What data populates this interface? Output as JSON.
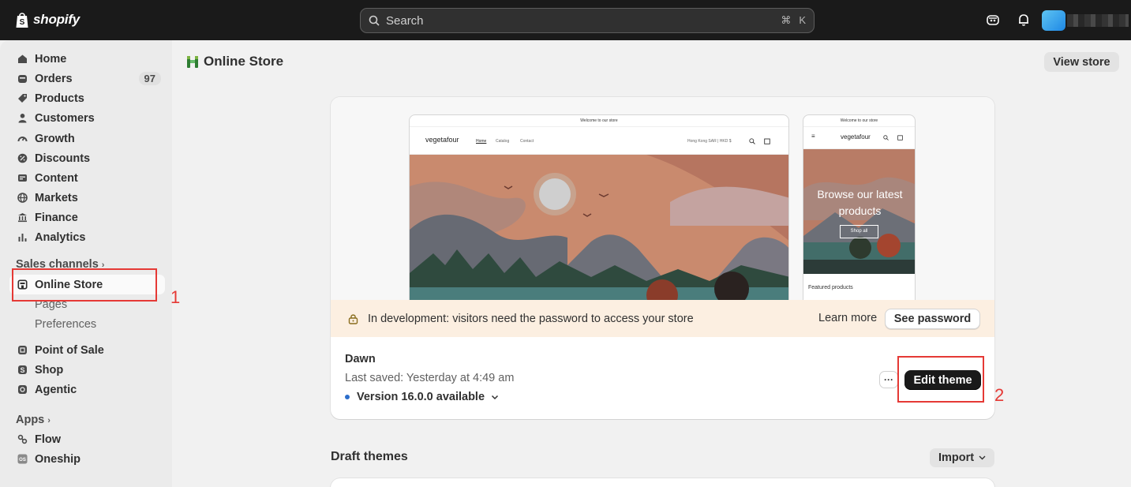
{
  "topbar": {
    "brand": "shopify",
    "search_placeholder": "Search",
    "shortcut_cmd": "⌘",
    "shortcut_key": "K"
  },
  "sidebar": {
    "items": [
      {
        "label": "Home",
        "icon": "home-icon"
      },
      {
        "label": "Orders",
        "icon": "orders-icon",
        "badge": "97"
      },
      {
        "label": "Products",
        "icon": "tag-icon"
      },
      {
        "label": "Customers",
        "icon": "person-icon"
      },
      {
        "label": "Growth",
        "icon": "gauge-icon"
      },
      {
        "label": "Discounts",
        "icon": "discount-icon"
      },
      {
        "label": "Content",
        "icon": "content-icon"
      },
      {
        "label": "Markets",
        "icon": "globe-icon"
      },
      {
        "label": "Finance",
        "icon": "bank-icon"
      },
      {
        "label": "Analytics",
        "icon": "bar-chart-icon"
      }
    ],
    "sales_channels_label": "Sales channels",
    "online_store": "Online Store",
    "sub_items": [
      "Pages",
      "Preferences"
    ],
    "channels": [
      {
        "label": "Point of Sale",
        "icon": "pos-icon"
      },
      {
        "label": "Shop",
        "icon": "shop-icon"
      },
      {
        "label": "Agentic",
        "icon": "agentic-icon"
      }
    ],
    "apps_label": "Apps",
    "apps": [
      {
        "label": "Flow",
        "icon": "flow-icon"
      },
      {
        "label": "Oneship",
        "icon": "oneship-icon"
      }
    ]
  },
  "header": {
    "title": "Online Store",
    "view_store": "View store"
  },
  "preview": {
    "announcement": "Welcome to our store",
    "store_name": "vegetafour",
    "nav": [
      "Home",
      "Catalog",
      "Contact"
    ],
    "currency": "Hong Kong SAR | HKD $",
    "mobile_hero_title": "Browse our latest products",
    "mobile_shop_all": "Shop all",
    "mobile_featured": "Featured products"
  },
  "dev_banner": {
    "message": "In development: visitors need the password to access your store",
    "learn_more": "Learn more",
    "see_password": "See password"
  },
  "theme": {
    "name": "Dawn",
    "last_saved": "Last saved: Yesterday at 4:49 am",
    "version": "Version 16.0.0 available",
    "more": "···",
    "edit": "Edit theme"
  },
  "draft": {
    "title": "Draft themes",
    "import": "Import"
  },
  "annotations": [
    "1",
    "2"
  ],
  "colors": {
    "topbar": "#1a1a1a",
    "sidebar": "#ebebeb",
    "primary_button": "#1a1a1a",
    "banner": "#fcefe1",
    "annotation": "#e53935",
    "version_dot": "#2c6ecb"
  }
}
